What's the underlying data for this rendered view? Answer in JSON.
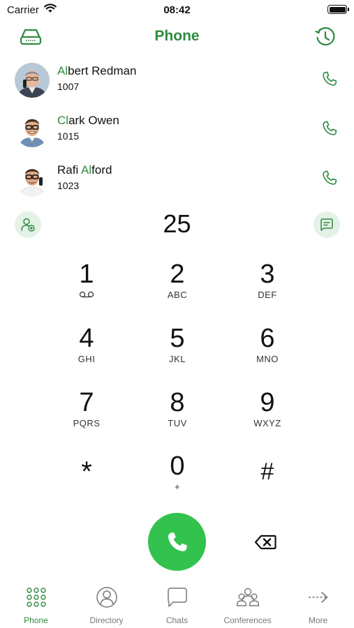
{
  "status_bar": {
    "carrier": "Carrier",
    "time": "08:42"
  },
  "header": {
    "title": "Phone",
    "left_icon": "voicemail-box-icon",
    "right_icon": "history-icon"
  },
  "contacts": [
    {
      "name_highlight": "Al",
      "name_rest": "bert Redman",
      "ext": "1007"
    },
    {
      "name_highlight": "Cl",
      "name_rest": "ark Owen",
      "ext": "1015"
    },
    {
      "name_prefix": "Rafi ",
      "name_highlight": "Al",
      "name_rest": "ford",
      "ext": "1023"
    }
  ],
  "dialer": {
    "number": "25"
  },
  "keypad": [
    {
      "digit": "1",
      "letters": ""
    },
    {
      "digit": "2",
      "letters": "ABC"
    },
    {
      "digit": "3",
      "letters": "DEF"
    },
    {
      "digit": "4",
      "letters": "GHI"
    },
    {
      "digit": "5",
      "letters": "JKL"
    },
    {
      "digit": "6",
      "letters": "MNO"
    },
    {
      "digit": "7",
      "letters": "PQRS"
    },
    {
      "digit": "8",
      "letters": "TUV"
    },
    {
      "digit": "9",
      "letters": "WXYZ"
    },
    {
      "digit": "*",
      "letters": ""
    },
    {
      "digit": "0",
      "letters": "+"
    },
    {
      "digit": "#",
      "letters": ""
    }
  ],
  "tabs": [
    {
      "label": "Phone",
      "icon": "keypad-grid-icon",
      "active": true
    },
    {
      "label": "Directory",
      "icon": "person-circle-icon",
      "active": false
    },
    {
      "label": "Chats",
      "icon": "chat-bubble-icon",
      "active": false
    },
    {
      "label": "Conferences",
      "icon": "group-icon",
      "active": false
    },
    {
      "label": "More",
      "icon": "arrow-right-icon",
      "active": false
    }
  ],
  "colors": {
    "accent": "#2e8b3f",
    "call_green": "#33c24d",
    "soft_green": "#e4f1e7"
  }
}
